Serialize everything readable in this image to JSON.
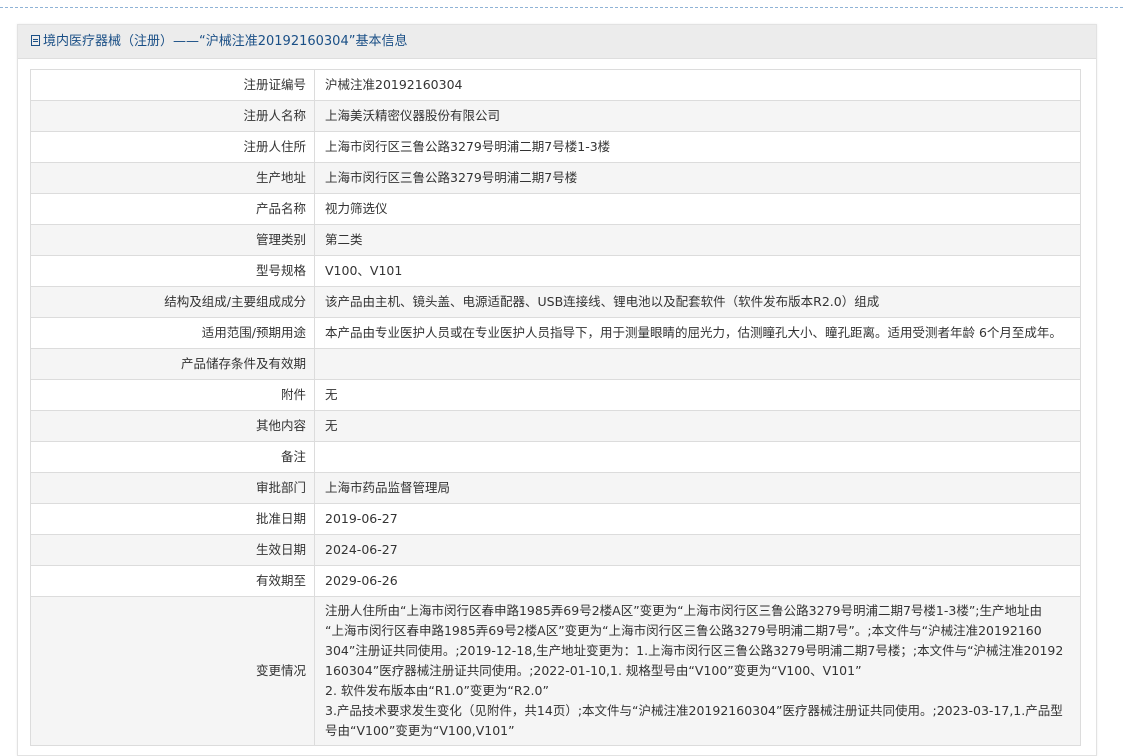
{
  "header": {
    "title": "境内医疗器械（注册）——“沪械注准20192160304”基本信息"
  },
  "rows": [
    {
      "label": "注册证编号",
      "value": "沪械注准20192160304"
    },
    {
      "label": "注册人名称",
      "value": "上海美沃精密仪器股份有限公司"
    },
    {
      "label": "注册人住所",
      "value": "上海市闵行区三鲁公路3279号明浦二期7号楼1-3楼"
    },
    {
      "label": "生产地址",
      "value": "上海市闵行区三鲁公路3279号明浦二期7号楼"
    },
    {
      "label": "产品名称",
      "value": "视力筛选仪"
    },
    {
      "label": "管理类别",
      "value": "第二类"
    },
    {
      "label": "型号规格",
      "value": "V100、V101"
    },
    {
      "label": "结构及组成/主要组成成分",
      "value": "该产品由主机、镜头盖、电源适配器、USB连接线、锂电池以及配套软件（软件发布版本R2.0）组成"
    },
    {
      "label": "适用范围/预期用途",
      "value": "本产品由专业医护人员或在专业医护人员指导下，用于测量眼睛的屈光力，估测瞳孔大小、瞳孔距离。适用受测者年龄 6个月至成年。"
    },
    {
      "label": "产品储存条件及有效期",
      "value": ""
    },
    {
      "label": "附件",
      "value": "无"
    },
    {
      "label": "其他内容",
      "value": "无"
    },
    {
      "label": "备注",
      "value": ""
    },
    {
      "label": "审批部门",
      "value": "上海市药品监督管理局"
    },
    {
      "label": "批准日期",
      "value": "2019-06-27"
    },
    {
      "label": "生效日期",
      "value": "2024-06-27"
    },
    {
      "label": "有效期至",
      "value": "2029-06-26"
    }
  ],
  "change": {
    "label": "变更情况",
    "lines": [
      "注册人住所由“上海市闵行区春申路1985弄69号2楼A区”变更为“上海市闵行区三鲁公路3279号明浦二期7号楼1-3楼”;生产地址由",
      "“上海市闵行区春申路1985弄69号2楼A区”变更为“上海市闵行区三鲁公路3279号明浦二期7号”。;本文件与“沪械注准20192160",
      "304”注册证共同使用。;2019-12-18,生产地址变更为：1.上海市闵行区三鲁公路3279号明浦二期7号楼；;本文件与“沪械注准20192",
      "160304”医疗器械注册证共同使用。;2022-01-10,1. 规格型号由“V100”变更为“V100、V101”",
      "2. 软件发布版本由“R1.0”变更为“R2.0”",
      "3.产品技术要求发生变化（见附件，共14页）;本文件与“沪械注准20192160304”医疗器械注册证共同使用。;2023-03-17,1.产品型",
      "号由“V100”变更为“V100,V101”"
    ]
  }
}
